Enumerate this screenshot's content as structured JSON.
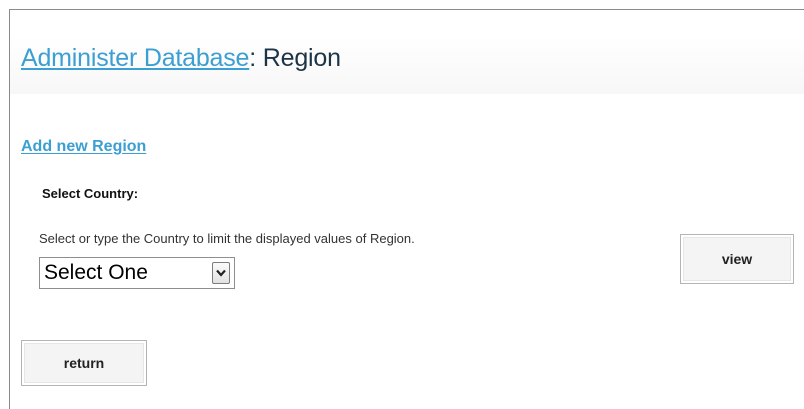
{
  "page": {
    "title_link": "Administer Database",
    "title_separator": ":",
    "title_suffix": " Region"
  },
  "actions": {
    "add_link": "Add new Region"
  },
  "filter": {
    "label": "Select Country:",
    "help": "Select or type the Country to limit the displayed values of Region.",
    "select_value": "Select One",
    "select_arrow_icon": "chevron-down-icon"
  },
  "buttons": {
    "view": "view",
    "return": "return"
  },
  "colors": {
    "link": "#3b9fd3",
    "title_text": "#1d3447",
    "button_bg": "#f4f4f4",
    "button_border": "#b4b4b4"
  }
}
